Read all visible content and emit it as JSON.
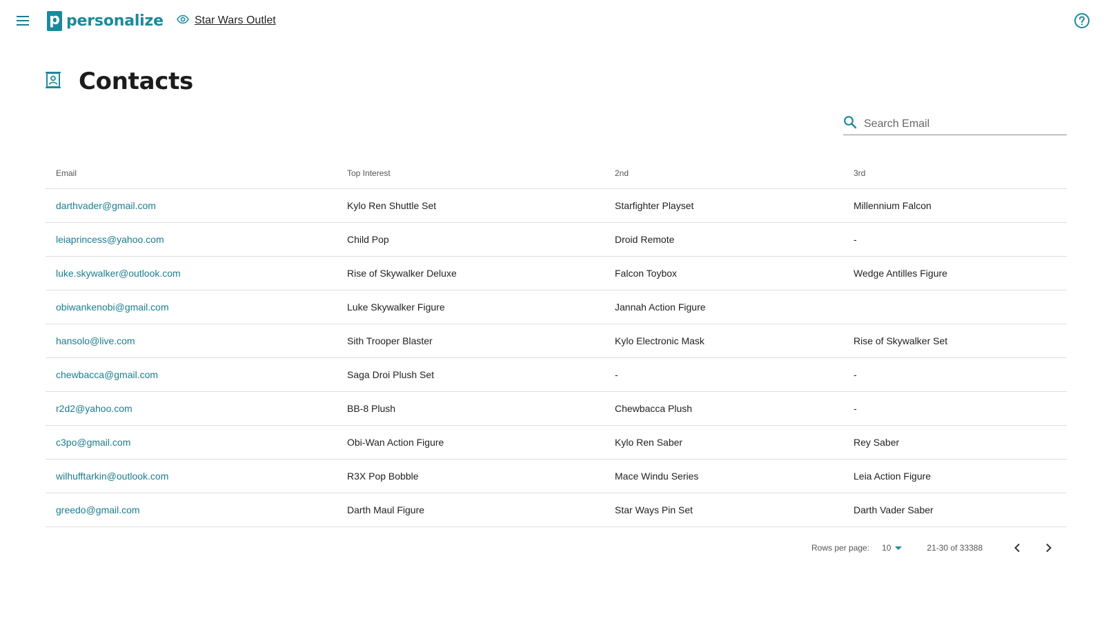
{
  "app": {
    "brand_letter": "p",
    "brand": "personalize",
    "store_name": "Star Wars Outlet"
  },
  "colors": {
    "accent": "#1a8a9b",
    "link": "#1a7d8e",
    "divider": "#dedede"
  },
  "icons": {
    "menu": "menu-icon",
    "store": "eye-icon",
    "help": "help-circle-icon",
    "page": "contact-book-icon",
    "search": "search-icon",
    "prev": "chevron-left-icon",
    "next": "chevron-right-icon"
  },
  "page": {
    "title": "Contacts"
  },
  "search": {
    "placeholder": "Search Email",
    "value": ""
  },
  "table": {
    "headers": [
      "Email",
      "Top Interest",
      "2nd",
      "3rd"
    ],
    "rows": [
      [
        "darthvader@gmail.com",
        "Kylo Ren Shuttle Set",
        "Starfighter Playset",
        "Millennium Falcon"
      ],
      [
        "leiaprincess@yahoo.com",
        "Child Pop",
        "Droid Remote",
        "-"
      ],
      [
        "luke.skywalker@outlook.com",
        "Rise of Skywalker Deluxe",
        "Falcon Toybox",
        "Wedge Antilles Figure"
      ],
      [
        "obiwankenobi@gmail.com",
        "Luke Skywalker Figure",
        "Jannah Action Figure",
        ""
      ],
      [
        "hansolo@live.com",
        "Sith Trooper Blaster",
        "Kylo Electronic Mask",
        "Rise of Skywalker Set"
      ],
      [
        "chewbacca@gmail.com",
        "Saga Droi Plush Set",
        "-",
        "-"
      ],
      [
        "r2d2@yahoo.com",
        "BB-8 Plush",
        "Chewbacca Plush",
        "-"
      ],
      [
        "c3po@gmail.com",
        "Obi-Wan Action Figure",
        "Kylo Ren Saber",
        "Rey Saber"
      ],
      [
        "wilhufftarkin@outlook.com",
        "R3X Pop Bobble",
        "Mace Windu Series",
        "Leia Action Figure"
      ],
      [
        "greedo@gmail.com",
        "Darth Maul Figure",
        "Star Ways Pin Set",
        "Darth Vader Saber"
      ]
    ]
  },
  "pagination": {
    "rows_per_page_label": "Rows per page:",
    "rows_per_page": "10",
    "range": "21-30 of 33388"
  }
}
